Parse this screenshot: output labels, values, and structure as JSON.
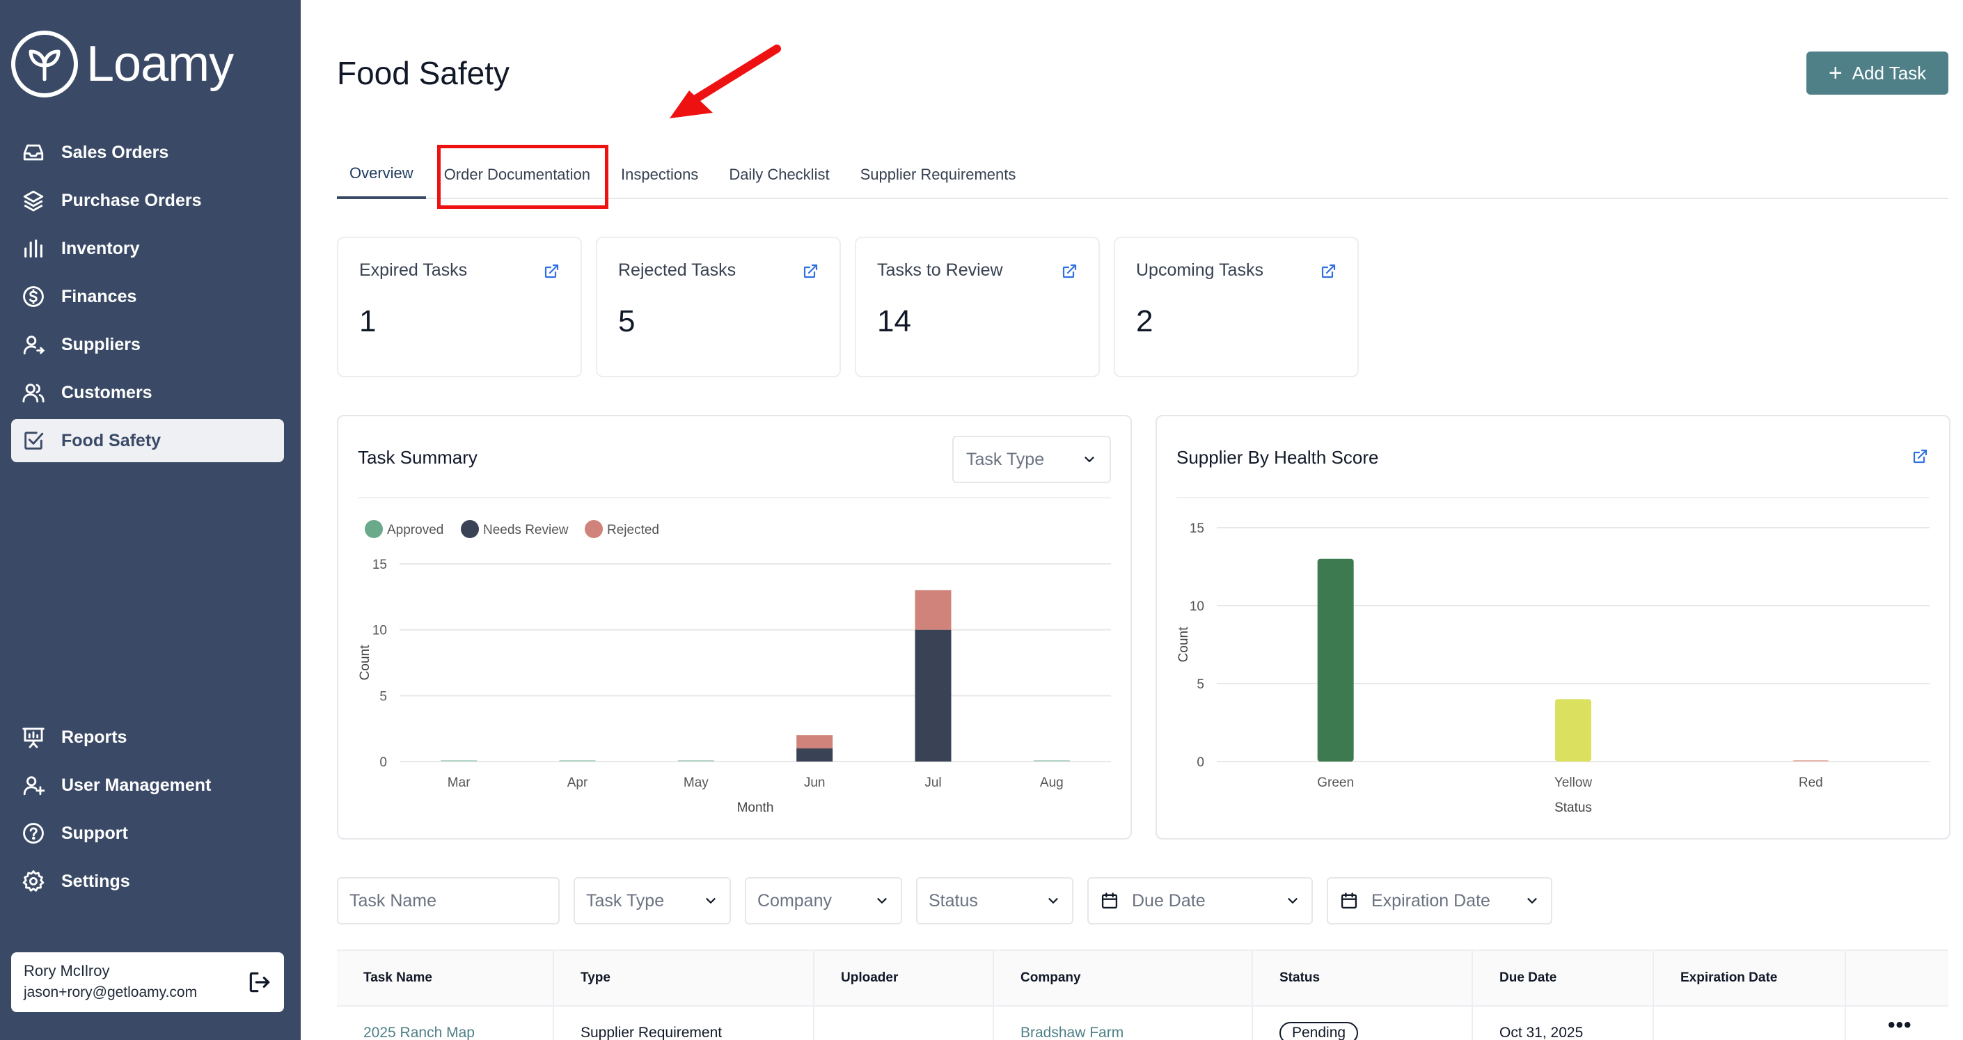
{
  "brand": {
    "name": "Loamy"
  },
  "sidebar": {
    "items": [
      {
        "label": "Sales Orders",
        "icon": "inbox-icon"
      },
      {
        "label": "Purchase Orders",
        "icon": "layers-icon"
      },
      {
        "label": "Inventory",
        "icon": "bars-icon"
      },
      {
        "label": "Finances",
        "icon": "dollar-circle-icon"
      },
      {
        "label": "Suppliers",
        "icon": "user-arrow-icon"
      },
      {
        "label": "Customers",
        "icon": "users-icon"
      },
      {
        "label": "Food Safety",
        "icon": "checkbox-icon",
        "active": true
      }
    ],
    "bottom_items": [
      {
        "label": "Reports",
        "icon": "presentation-icon"
      },
      {
        "label": "User Management",
        "icon": "user-plus-icon"
      },
      {
        "label": "Support",
        "icon": "help-circle-icon"
      },
      {
        "label": "Settings",
        "icon": "gear-icon"
      }
    ],
    "user": {
      "name": "Rory McIlroy",
      "email": "jason+rory@getloamy.com"
    }
  },
  "header": {
    "title": "Food Safety",
    "add_button": "Add Task"
  },
  "tabs": [
    {
      "label": "Overview",
      "active": true
    },
    {
      "label": "Order Documentation"
    },
    {
      "label": "Inspections"
    },
    {
      "label": "Daily Checklist"
    },
    {
      "label": "Supplier Requirements"
    }
  ],
  "stats": [
    {
      "title": "Expired Tasks",
      "value": "1"
    },
    {
      "title": "Rejected Tasks",
      "value": "5"
    },
    {
      "title": "Tasks to Review",
      "value": "14"
    },
    {
      "title": "Upcoming Tasks",
      "value": "2"
    }
  ],
  "task_summary": {
    "title": "Task Summary",
    "select_placeholder": "Task Type"
  },
  "supplier_health": {
    "title": "Supplier By Health Score"
  },
  "chart_data": [
    {
      "type": "bar",
      "stacked": true,
      "categories": [
        "Mar",
        "Apr",
        "May",
        "Jun",
        "Jul",
        "Aug"
      ],
      "series": [
        {
          "name": "Approved",
          "values": [
            0,
            0,
            0,
            0,
            0,
            0
          ],
          "color": "#6aaa8a"
        },
        {
          "name": "Needs Review",
          "values": [
            0,
            0,
            0,
            1,
            10,
            0
          ],
          "color": "#3a4356"
        },
        {
          "name": "Rejected",
          "values": [
            0,
            0,
            0,
            1,
            3,
            0
          ],
          "color": "#d0837a"
        }
      ],
      "xlabel": "Month",
      "ylabel": "Count",
      "ylim": [
        0,
        15
      ],
      "yticks": [
        0,
        5,
        10,
        15
      ],
      "legend": "top-left",
      "grid": true
    },
    {
      "type": "bar",
      "categories": [
        "Green",
        "Yellow",
        "Red"
      ],
      "values": [
        13,
        4,
        0
      ],
      "colors": [
        "#3d7a4f",
        "#dbe05e",
        "#e8b8b0"
      ],
      "xlabel": "Status",
      "ylabel": "Count",
      "ylim": [
        0,
        15
      ],
      "yticks": [
        0,
        5,
        10,
        15
      ],
      "grid": true
    }
  ],
  "filters": {
    "task_name": "Task Name",
    "task_type": "Task Type",
    "company": "Company",
    "status": "Status",
    "due_date": "Due Date",
    "expiration_date": "Expiration Date"
  },
  "table": {
    "columns": [
      "Task Name",
      "Type",
      "Uploader",
      "Company",
      "Status",
      "Due Date",
      "Expiration Date"
    ],
    "rows": [
      {
        "task_name": "2025 Ranch Map",
        "type": "Supplier Requirement",
        "uploader": "",
        "company": "Bradshaw Farm",
        "status": "Pending",
        "due_date": "Oct 31, 2025",
        "expiration_date": ""
      }
    ]
  }
}
